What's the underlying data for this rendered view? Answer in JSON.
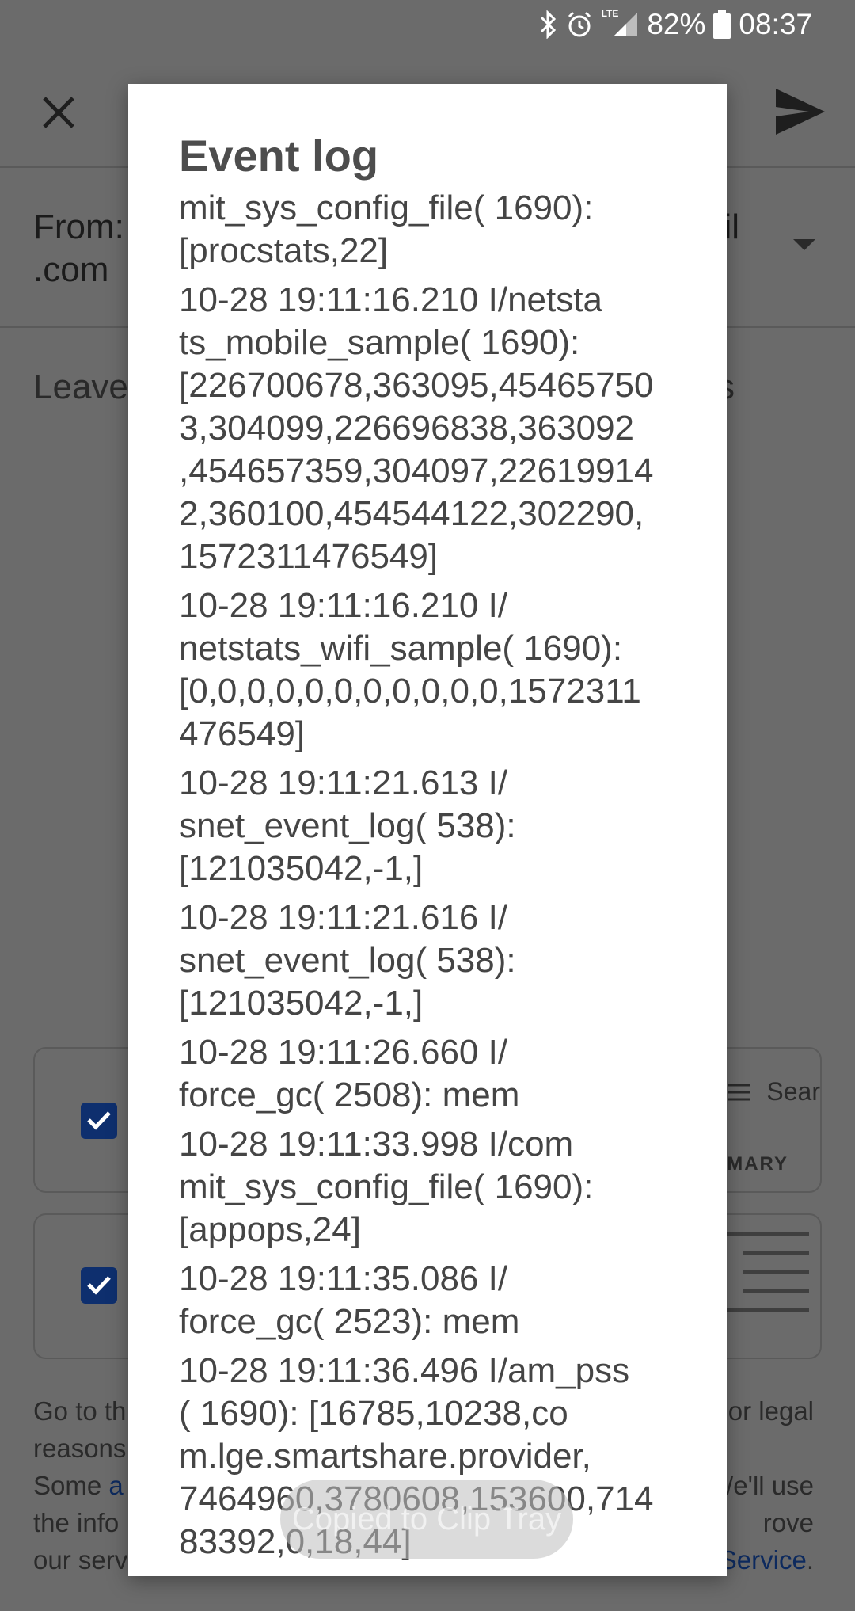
{
  "status_bar": {
    "network_type": "LTE",
    "battery": "82%",
    "time": "08:37"
  },
  "compose": {
    "from_label": "From:",
    "from_domain_suffix": ".com",
    "from_account_partial": "ail",
    "body_partial_left": "Leave",
    "body_partial_right": "s",
    "search_partial": "Sear",
    "summary_partial": "MARY",
    "footer_left_lines": [
      "Go to th",
      "reasons",
      "Some ",
      "the info",
      "our serv"
    ],
    "footer_link_fragment": "a",
    "footer_right_lines": [
      "or legal",
      "",
      "/e'll use",
      "rove",
      "Service."
    ],
    "footer_right_link": "Service"
  },
  "dialog": {
    "title": "Event log",
    "entries": [
      "mit_sys_config_file( 1690):\n[procstats,22]",
      "10-28 19:11:16.210 I/netsta\nts_mobile_sample( 1690):\n[226700678,363095,45465750\n3,304099,226696838,363092\n,454657359,304097,22619914\n2,360100,454544122,302290,\n1572311476549]",
      "10-28 19:11:16.210 I/\nnetstats_wifi_sample( 1690):\n[0,0,0,0,0,0,0,0,0,0,0,1572311\n476549]",
      "10-28 19:11:21.613 I/\nsnet_event_log(  538):\n[121035042,-1,]",
      "10-28 19:11:21.616 I/\nsnet_event_log(  538):\n[121035042,-1,]",
      "10-28 19:11:26.660 I/\nforce_gc( 2508): mem",
      "10-28 19:11:33.998 I/com\nmit_sys_config_file( 1690):\n[appops,24]",
      "10-28 19:11:35.086 I/\nforce_gc( 2523): mem",
      "10-28 19:11:36.496 I/am_pss\n( 1690): [16785,10238,co\nm.lge.smartshare.provider,\n7464960,3780608,153600,714\n83392,0,18,44]"
    ]
  },
  "toast": {
    "text": "Copied to Clip Tray"
  }
}
